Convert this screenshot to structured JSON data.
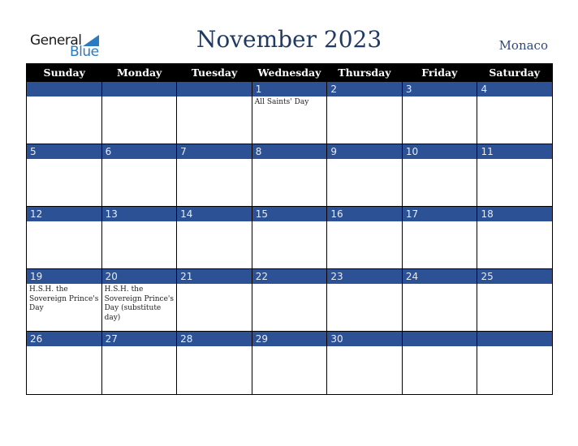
{
  "logo": {
    "general": "General",
    "blue": "Blue"
  },
  "title": "November 2023",
  "country": "Monaco",
  "colors": {
    "band": "#2c5295",
    "header": "#000000",
    "title": "#213a63",
    "logo_blue": "#2b7bc0"
  },
  "weekdays": [
    "Sunday",
    "Monday",
    "Tuesday",
    "Wednesday",
    "Thursday",
    "Friday",
    "Saturday"
  ],
  "weeks": [
    [
      {
        "day": "",
        "event": ""
      },
      {
        "day": "",
        "event": ""
      },
      {
        "day": "",
        "event": ""
      },
      {
        "day": "1",
        "event": "All Saints' Day"
      },
      {
        "day": "2",
        "event": ""
      },
      {
        "day": "3",
        "event": ""
      },
      {
        "day": "4",
        "event": ""
      }
    ],
    [
      {
        "day": "5",
        "event": ""
      },
      {
        "day": "6",
        "event": ""
      },
      {
        "day": "7",
        "event": ""
      },
      {
        "day": "8",
        "event": ""
      },
      {
        "day": "9",
        "event": ""
      },
      {
        "day": "10",
        "event": ""
      },
      {
        "day": "11",
        "event": ""
      }
    ],
    [
      {
        "day": "12",
        "event": ""
      },
      {
        "day": "13",
        "event": ""
      },
      {
        "day": "14",
        "event": ""
      },
      {
        "day": "15",
        "event": ""
      },
      {
        "day": "16",
        "event": ""
      },
      {
        "day": "17",
        "event": ""
      },
      {
        "day": "18",
        "event": ""
      }
    ],
    [
      {
        "day": "19",
        "event": "H.S.H. the Sovereign Prince's Day"
      },
      {
        "day": "20",
        "event": "H.S.H. the Sovereign Prince's Day (substitute day)"
      },
      {
        "day": "21",
        "event": ""
      },
      {
        "day": "22",
        "event": ""
      },
      {
        "day": "23",
        "event": ""
      },
      {
        "day": "24",
        "event": ""
      },
      {
        "day": "25",
        "event": ""
      }
    ],
    [
      {
        "day": "26",
        "event": ""
      },
      {
        "day": "27",
        "event": ""
      },
      {
        "day": "28",
        "event": ""
      },
      {
        "day": "29",
        "event": ""
      },
      {
        "day": "30",
        "event": ""
      },
      {
        "day": "",
        "event": ""
      },
      {
        "day": "",
        "event": ""
      }
    ]
  ]
}
